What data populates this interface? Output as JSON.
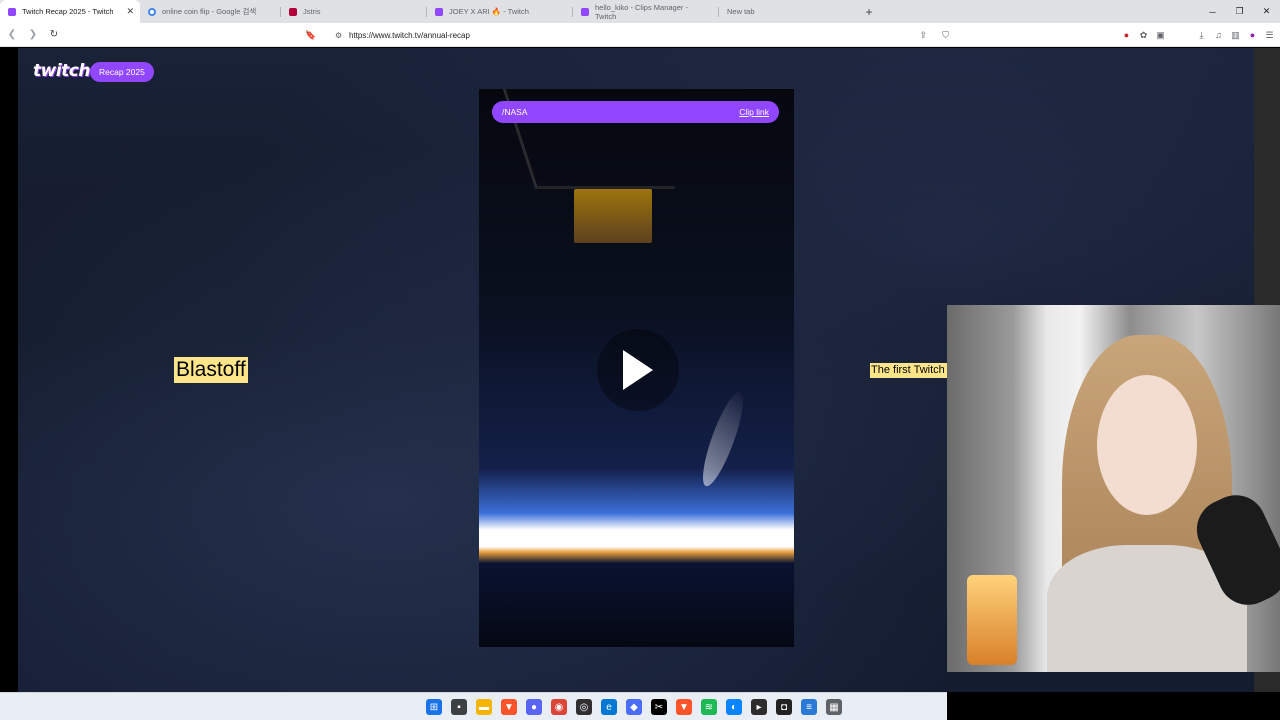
{
  "tabs": [
    {
      "label": "Twitch Recap 2025 - Twitch",
      "active": true,
      "favicon_color": "#9146ff"
    },
    {
      "label": "online coin flip - Google 검색",
      "active": false,
      "favicon_color": "#4285f4"
    },
    {
      "label": "Jstris",
      "active": false,
      "favicon_color": "#b3003b"
    },
    {
      "label": "JOEY X ARI 🔥 - Twitch",
      "active": false,
      "favicon_color": "#9146ff"
    },
    {
      "label": "hello_kiko - Clips Manager - Twitch",
      "active": false,
      "favicon_color": "#9146ff"
    },
    {
      "label": "New tab",
      "active": false,
      "favicon_color": ""
    }
  ],
  "new_tab_symbol": "+",
  "address_bar": {
    "url": "https://www.twitch.tv/annual-recap"
  },
  "page": {
    "logo_text": "twitch",
    "recap_button": "Recap 2025",
    "headline_left": "Blastoff",
    "text_right": "The first Twitch"
  },
  "clip": {
    "channel": "/NASA",
    "clip_link": "Clip link"
  },
  "taskbar": {
    "apps": [
      "windows-start-icon",
      "file-icon",
      "folder-icon",
      "brave-icon",
      "discord-icon",
      "chrome-icon",
      "obs-icon",
      "edge-icon",
      "app-icon",
      "capcut-icon",
      "brave-icon-2",
      "spotify-icon",
      "edge-icon-2",
      "terminal-icon",
      "app-icon-2",
      "notes-icon",
      "calculator-icon"
    ]
  },
  "colors": {
    "twitch_purple": "#9146ff",
    "highlight_yellow": "#fde68a"
  }
}
